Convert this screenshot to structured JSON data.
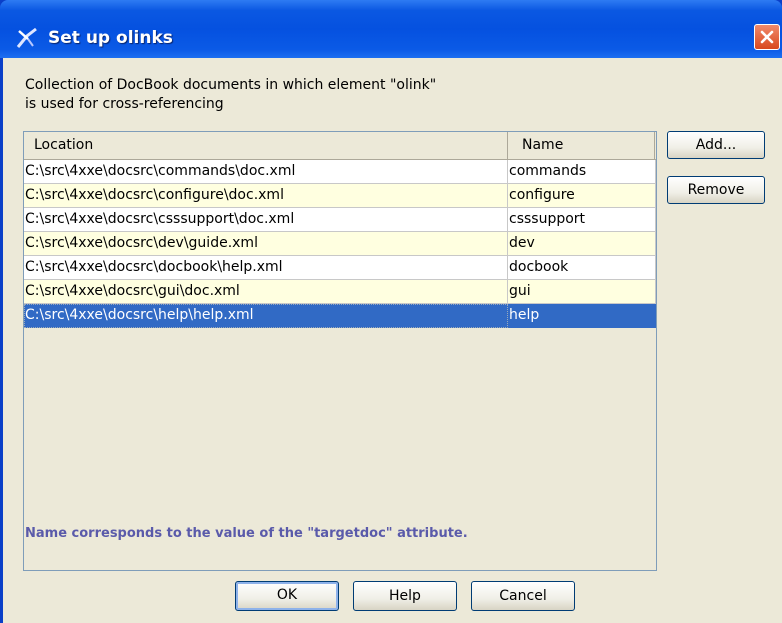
{
  "window": {
    "title": "Set up olinks"
  },
  "description": {
    "line1": "Collection of DocBook documents in which element \"olink\"",
    "line2": "is used for cross-referencing"
  },
  "table": {
    "columns": [
      "Location",
      "Name"
    ],
    "rows": [
      {
        "location": "C:\\src\\4xxe\\docsrc\\commands\\doc.xml",
        "name": "commands"
      },
      {
        "location": "C:\\src\\4xxe\\docsrc\\configure\\doc.xml",
        "name": "configure"
      },
      {
        "location": "C:\\src\\4xxe\\docsrc\\csssupport\\doc.xml",
        "name": "csssupport"
      },
      {
        "location": "C:\\src\\4xxe\\docsrc\\dev\\guide.xml",
        "name": "dev"
      },
      {
        "location": "C:\\src\\4xxe\\docsrc\\docbook\\help.xml",
        "name": "docbook"
      },
      {
        "location": "C:\\src\\4xxe\\docsrc\\gui\\doc.xml",
        "name": "gui"
      },
      {
        "location": "C:\\src\\4xxe\\docsrc\\help\\help.xml",
        "name": "help"
      }
    ],
    "selected_row": 6
  },
  "side_buttons": {
    "add_label": "Add...",
    "remove_label": "Remove"
  },
  "hint": "Name corresponds to the value of the \"targetdoc\" attribute.",
  "footer_buttons": {
    "ok_label": "OK",
    "help_label": "Help",
    "cancel_label": "Cancel"
  },
  "colors": {
    "titlebar": "#0551e0",
    "selection": "#316ac5",
    "row_alt": "#ffffe0",
    "hint_text": "#5a5aaa",
    "dialog_bg": "#ece9d8"
  },
  "icons": {
    "title": "xxe-app-icon",
    "close": "close-icon"
  }
}
